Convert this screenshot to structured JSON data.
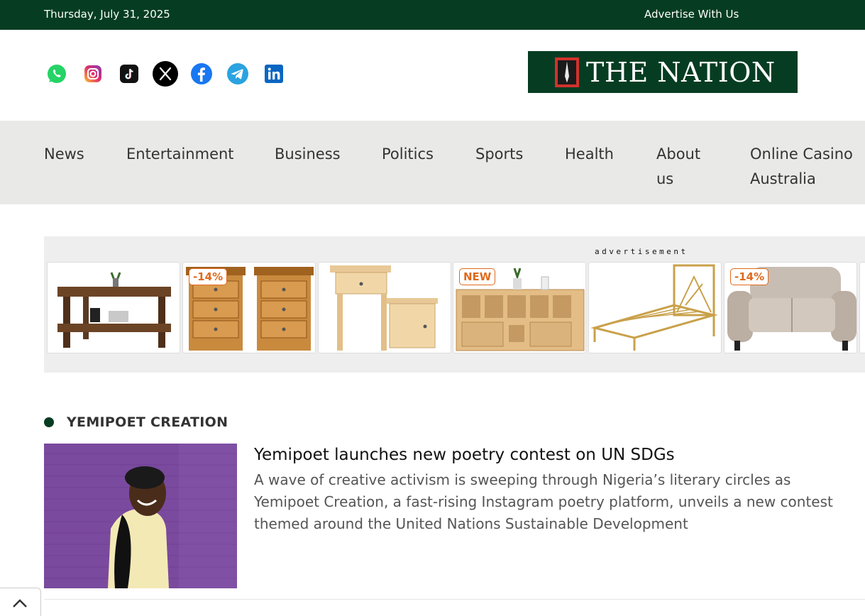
{
  "topbar": {
    "date": "Thursday, July 31, 2025",
    "advertise": "Advertise With Us"
  },
  "header": {
    "socials": [
      "whatsapp-icon",
      "instagram-icon",
      "tiktok-icon",
      "x-icon",
      "facebook-icon",
      "telegram-icon",
      "linkedin-icon"
    ],
    "logo_text": "THE NATION"
  },
  "nav": {
    "items": [
      "News",
      "Entertainment",
      "Business",
      "Politics",
      "Sports",
      "Health",
      "About\nus",
      "Online Casino\nAustralia"
    ]
  },
  "ad": {
    "label": "advertisement",
    "cards": [
      {
        "name": "coffee-table",
        "badge": ""
      },
      {
        "name": "nightstand-pair",
        "badge": "-14%"
      },
      {
        "name": "side-table",
        "badge": ""
      },
      {
        "name": "storage-cabinet",
        "badge": "NEW"
      },
      {
        "name": "metal-bed-frame",
        "badge": ""
      },
      {
        "name": "loveseat-sofa",
        "badge": "-14%"
      }
    ]
  },
  "section": {
    "title": "YEMIPOET CREATION",
    "article": {
      "title": "Yemipoet launches new poetry contest on UN SDGs",
      "excerpt_lines": [
        "A wave of creative activism is sweeping through Nigeria’s literary circles as",
        "Yemipoet Creation, a fast-rising Instagram poetry platform, unveils a new contest",
        "themed around the United Nations Sustainable Development"
      ]
    }
  },
  "colors": {
    "brand_green": "#063d22",
    "nav_bg": "#e9eae8",
    "badge_orange": "#e06a1c"
  }
}
